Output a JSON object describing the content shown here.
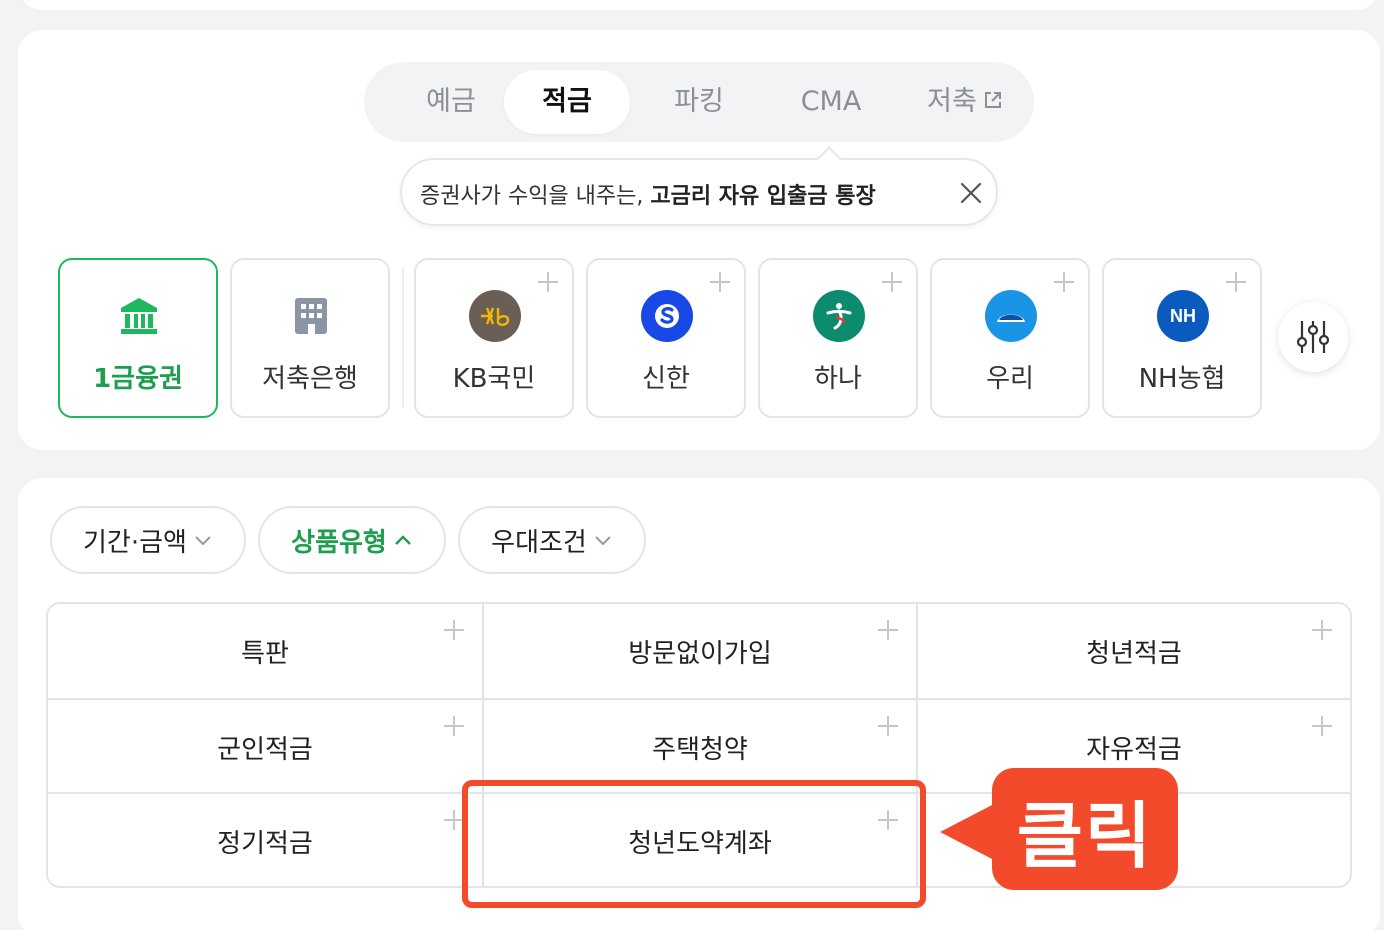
{
  "tabs": [
    {
      "label": "예금",
      "active": false
    },
    {
      "label": "적금",
      "active": true
    },
    {
      "label": "파킹",
      "active": false
    },
    {
      "label": "CMA",
      "active": false
    },
    {
      "label": "저축",
      "active": false,
      "external": true
    }
  ],
  "tooltip": {
    "prefix": "증권사가 수익을 내주는, ",
    "emphasis": "고금리 자유 입출금 통장"
  },
  "banks": [
    {
      "label": "1금융권",
      "icon": "bank-building-icon",
      "active": true
    },
    {
      "label": "저축은행",
      "icon": "office-building-icon",
      "active": false
    },
    {
      "label": "KB국민",
      "icon": "kb-logo-icon",
      "active": false
    },
    {
      "label": "신한",
      "icon": "shinhan-logo-icon",
      "active": false
    },
    {
      "label": "하나",
      "icon": "hana-logo-icon",
      "active": false
    },
    {
      "label": "우리",
      "icon": "woori-logo-icon",
      "active": false
    },
    {
      "label": "NH농협",
      "icon": "nh-logo-icon",
      "logo_text": "NH",
      "active": false
    }
  ],
  "filters": [
    {
      "label": "기간·금액",
      "active": false,
      "expanded": false
    },
    {
      "label": "상품유형",
      "active": true,
      "expanded": true
    },
    {
      "label": "우대조건",
      "active": false,
      "expanded": false
    }
  ],
  "product_types": [
    "특판",
    "방문없이가입",
    "청년적금",
    "군인적금",
    "주택청약",
    "자유적금",
    "정기적금",
    "청년도약계좌"
  ],
  "annotation": {
    "label": "클릭"
  },
  "colors": {
    "accent_green": "#1f9e4f",
    "callout_red": "#f24a2a",
    "kb": "#6b5f55",
    "shinhan": "#1848e6",
    "hana": "#0d8b6e",
    "woori": "#1a95e6",
    "nh": "#0a5bbd"
  }
}
